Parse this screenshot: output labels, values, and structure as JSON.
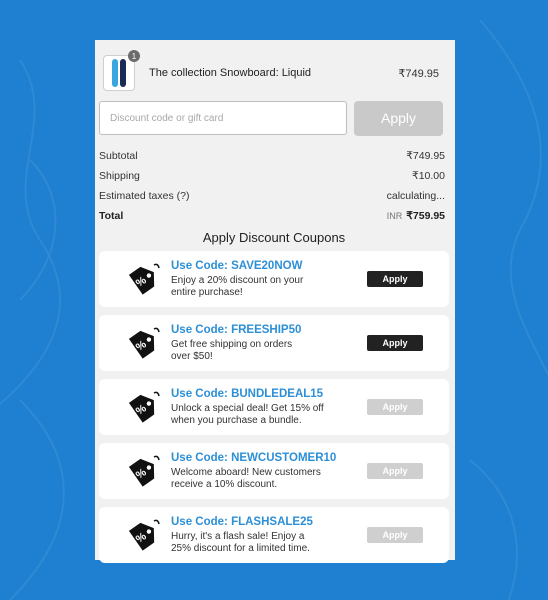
{
  "product": {
    "title": "The collection Snowboard: Liquid",
    "price": "₹749.95",
    "quantity": "1"
  },
  "discount": {
    "placeholder": "Discount code or gift card",
    "apply_label": "Apply"
  },
  "summary": {
    "subtotal_label": "Subtotal",
    "subtotal_value": "₹749.95",
    "shipping_label": "Shipping",
    "shipping_value": "₹10.00",
    "taxes_label": "Estimated taxes (?)",
    "taxes_value": "calculating...",
    "total_label": "Total",
    "total_currency": "INR",
    "total_value": "₹759.95"
  },
  "coupons": {
    "title": "Apply Discount Coupons",
    "items": [
      {
        "code": "Use Code: SAVE20NOW",
        "line1": "Enjoy a 20% discount on your",
        "line2": "entire purchase!",
        "button": "Apply",
        "enabled": true
      },
      {
        "code": "Use Code: FREESHIP50",
        "line1": "Get free shipping on orders",
        "line2": "over $50!",
        "button": "Apply",
        "enabled": true
      },
      {
        "code": "Use Code: BUNDLEDEAL15",
        "line1": "Unlock a special deal! Get 15% off",
        "line2": "when you purchase a bundle.",
        "button": "Apply",
        "enabled": false
      },
      {
        "code": "Use Code: NEWCUSTOMER10",
        "line1": "Welcome aboard! New customers",
        "line2": "receive a 10% discount.",
        "button": "Apply",
        "enabled": false
      },
      {
        "code": "Use Code: FLASHSALE25",
        "line1": "Hurry, it's a flash sale! Enjoy a",
        "line2": "25% discount for a limited time.",
        "button": "Apply",
        "enabled": false
      }
    ]
  },
  "colors": {
    "background": "#1f7fd0",
    "code_blue": "#2d8fd6",
    "button_active": "#222222",
    "button_disabled": "#cfcfcf"
  }
}
